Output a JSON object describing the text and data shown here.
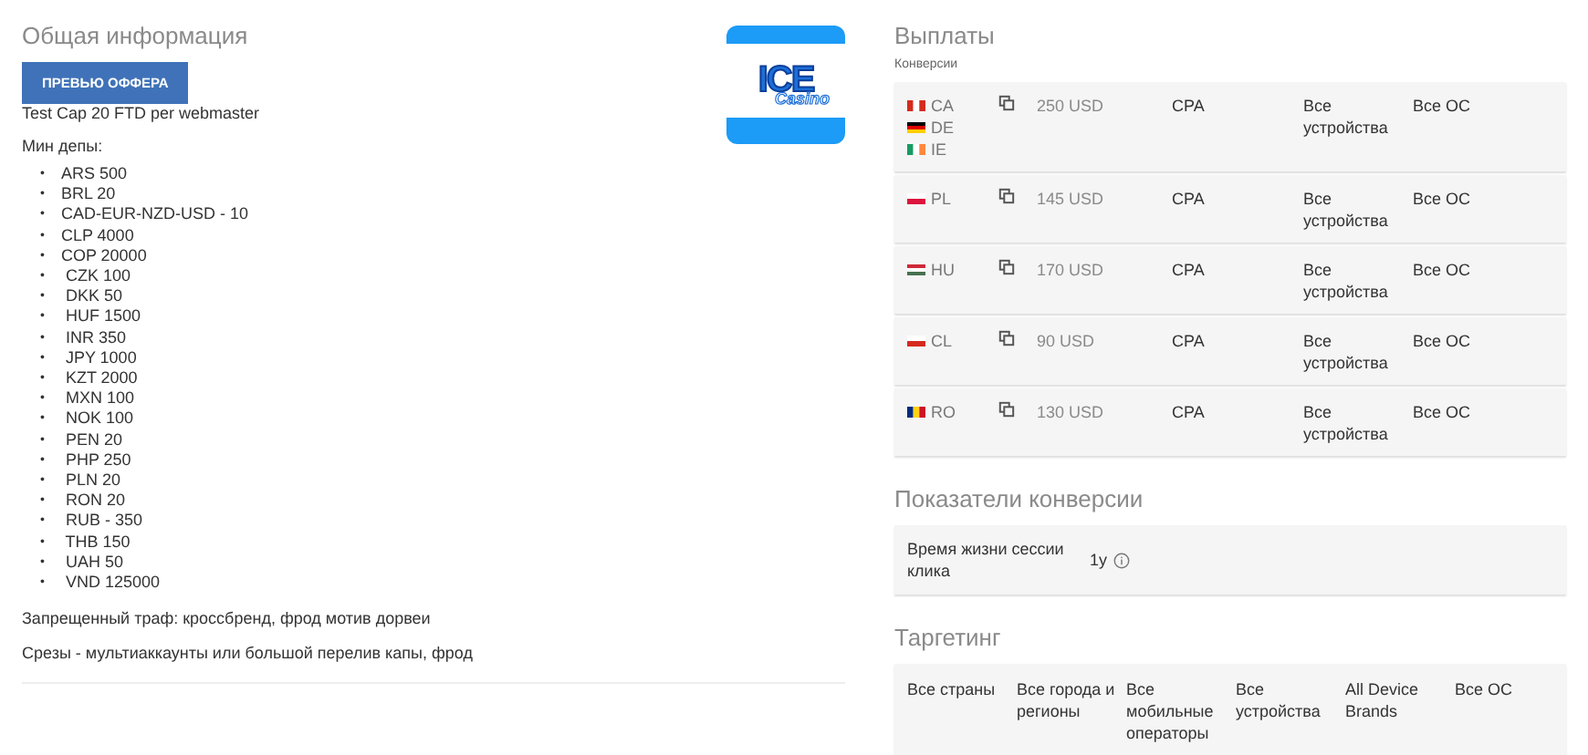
{
  "general": {
    "title": "Общая информация",
    "preview_button": "ПРЕВЬЮ ОФФЕРА",
    "cap_note": "Test Cap 20 FTD per webmaster",
    "min_deposit_label": "Мин депы:",
    "min_deposits": [
      {
        "marker": "•",
        "text": "ARS 500"
      },
      {
        "marker": "•",
        "text": "BRL 20"
      },
      {
        "marker": "•",
        "text": "CAD-EUR-NZD-USD - 10"
      },
      {
        "marker": "•",
        "text": "CLP 4000"
      },
      {
        "marker": "•",
        "text": "COP 20000"
      },
      {
        "marker": "•",
        "text": " CZK 100"
      },
      {
        "marker": "•",
        "text": " DKK 50"
      },
      {
        "marker": "•",
        "text": " HUF 1500"
      },
      {
        "marker": "•",
        "text": " INR 350"
      },
      {
        "marker": "•",
        "text": " JPY 1000"
      },
      {
        "marker": "•",
        "text": " KZT 2000"
      },
      {
        "marker": "•",
        "text": " MXN 100"
      },
      {
        "marker": "•",
        "text": " NOK 100"
      },
      {
        "marker": "•",
        "text": " PEN 20"
      },
      {
        "marker": "•",
        "text": " PHP 250"
      },
      {
        "marker": "•",
        "text": " PLN 20"
      },
      {
        "marker": "•",
        "text": " RON 20"
      },
      {
        "marker": "•",
        "text": " RUB - 350"
      },
      {
        "marker": "•",
        "text": " THB 150"
      },
      {
        "marker": "•",
        "text": " UAH 50"
      },
      {
        "marker": "•",
        "text": " VND 125000"
      }
    ],
    "forbidden_traffic": "Запрещенный траф: кроссбренд, фрод мотив дорвеи",
    "cuts": "Срезы - мультиаккаунты или большой перелив капы, фрод",
    "logo": {
      "text": "ICE",
      "subtext": "Casino"
    }
  },
  "payouts": {
    "title": "Выплаты",
    "subtitle": "Конверсии",
    "rows": [
      {
        "countries": [
          "CA",
          "DE",
          "IE"
        ],
        "amount": "250 USD",
        "type": "CPA",
        "devices": "Все устройства",
        "os": "Все ОС"
      },
      {
        "countries": [
          "PL"
        ],
        "amount": "145 USD",
        "type": "CPA",
        "devices": "Все устройства",
        "os": "Все ОС"
      },
      {
        "countries": [
          "HU"
        ],
        "amount": "170 USD",
        "type": "CPA",
        "devices": "Все устройства",
        "os": "Все ОС"
      },
      {
        "countries": [
          "CL"
        ],
        "amount": "90 USD",
        "type": "CPA",
        "devices": "Все устройства",
        "os": "Все ОС"
      },
      {
        "countries": [
          "RO"
        ],
        "amount": "130 USD",
        "type": "CPA",
        "devices": "Все устройства",
        "os": "Все ОС"
      }
    ]
  },
  "conversion_metrics": {
    "title": "Показатели конверсии",
    "label": "Время жизни сессии клика",
    "value": "1y"
  },
  "targeting": {
    "title": "Таргетинг",
    "values": [
      "Все страны",
      "Все города и регионы",
      "Все мобильные операторы",
      "Все устройства",
      "All Device Brands",
      "Все ОС"
    ]
  }
}
